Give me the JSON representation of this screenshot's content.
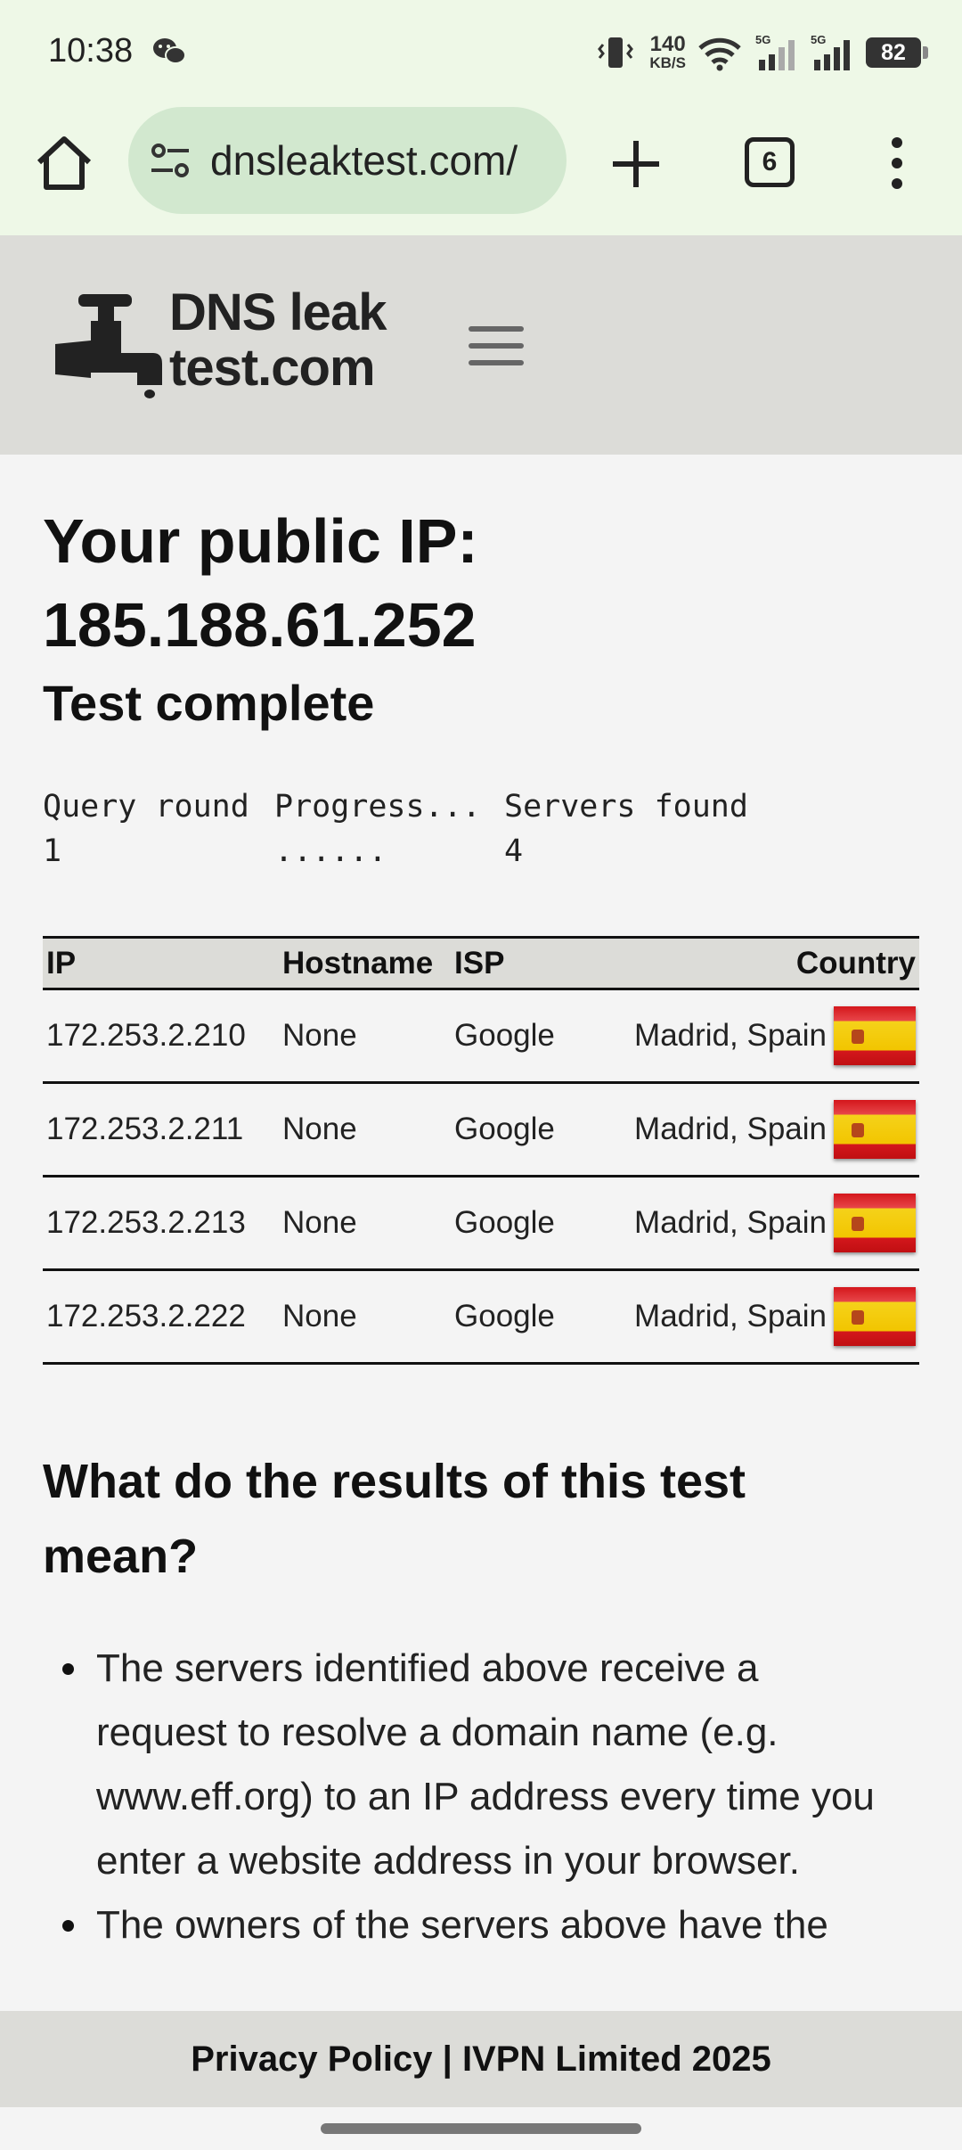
{
  "status_bar": {
    "time": "10:38",
    "net_speed_value": "140",
    "net_speed_unit": "KB/S",
    "battery": "82",
    "icons": [
      "wechat-icon",
      "vibrate-icon",
      "wifi-icon",
      "signal-5g-icon",
      "signal-5g-icon",
      "battery-icon"
    ]
  },
  "browser": {
    "url": "dnsleaktest.com/",
    "tab_count": "6"
  },
  "site": {
    "logo_line1": "DNS leak",
    "logo_line2": "test.com"
  },
  "main": {
    "ip_heading": "Your public IP: 185.188.61.252",
    "status": "Test complete",
    "query_table": {
      "headers": [
        "Query round",
        "Progress...",
        "Servers found"
      ],
      "values": [
        "1",
        "......",
        "4"
      ]
    },
    "servers_table": {
      "headers": [
        "IP",
        "Hostname",
        "ISP",
        "Country"
      ],
      "rows": [
        {
          "ip": "172.253.2.210",
          "hostname": "None",
          "isp": "Google",
          "location": "Madrid, Spain",
          "flag": "spain-flag-icon"
        },
        {
          "ip": "172.253.2.211",
          "hostname": "None",
          "isp": "Google",
          "location": "Madrid, Spain",
          "flag": "spain-flag-icon"
        },
        {
          "ip": "172.253.2.213",
          "hostname": "None",
          "isp": "Google",
          "location": "Madrid, Spain",
          "flag": "spain-flag-icon"
        },
        {
          "ip": "172.253.2.222",
          "hostname": "None",
          "isp": "Google",
          "location": "Madrid, Spain",
          "flag": "spain-flag-icon"
        }
      ]
    },
    "meaning_heading": "What do the results of this test mean?",
    "bullets": [
      "The servers identified above receive a request to resolve a domain name (e.g. www.eff.org) to an IP address every time you enter a website address in your browser.",
      "The owners of the servers above have the"
    ]
  },
  "footer": {
    "text": "Privacy Policy | IVPN Limited 2025"
  }
}
